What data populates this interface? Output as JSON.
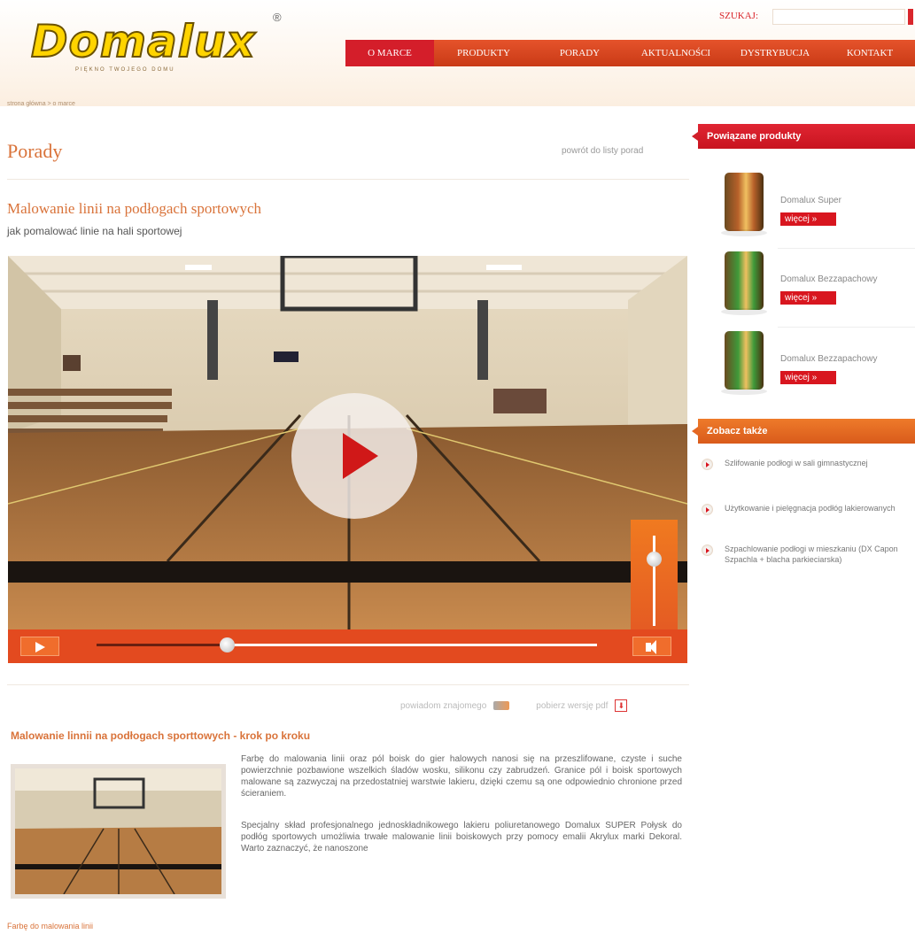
{
  "header": {
    "logo_text": "Domalux",
    "logo_tagline": "PIĘKNO TWOJEGO DOMU",
    "registered_mark": "®",
    "search_label": "SZUKAJ:",
    "search_placeholder": ""
  },
  "nav": {
    "items": [
      {
        "label": "O MARCE",
        "active": true
      },
      {
        "label": "PRODUKTY",
        "active": false
      },
      {
        "label": "PORADY",
        "active": false
      },
      {
        "label": "AKTUALNOŚCI",
        "active": false
      },
      {
        "label": "DYSTRYBUCJA",
        "active": false
      },
      {
        "label": "KONTAKT",
        "active": false
      }
    ]
  },
  "breadcrumb": "strona główna > o marce",
  "page": {
    "title": "Porady",
    "back_link": "powrót do listy porad"
  },
  "article": {
    "title": "Malowanie linii na podłogach sportowych",
    "subtitle": "jak pomalować linie na hali sportowej",
    "video": {
      "progress": 0.26,
      "volume": 0.75
    },
    "share": {
      "notify_friend": "powiadom znajomego",
      "download_pdf": "pobierz wersję pdf"
    },
    "steps_title": "Malowanie linnii na podłogach sporttowych - krok po kroku",
    "paragraph1": "Farbę do malowania linii oraz pól boisk do gier halowych nanosi się na przeszlifowane, czyste i suche powierzchnie pozbawione wszelkich śladów wosku, silikonu czy zabrudzeń. Granice pól i boisk sportowych malowane są zazwyczaj na przedostatniej warstwie lakieru, dzięki czemu są one odpowiednio chronione przed ścieraniem.",
    "paragraph2": "Specjalny skład profesjonalnego jednoskładnikowego lakieru poliuretanowego Domalux SUPER Połysk do podłóg sportowych umożliwia trwałe malowanie linii boiskowych przy pomocy emalii Akrylux marki Dekoral. Warto zaznaczyć, że nanoszone",
    "footer_link": "Farbę do malowania linii"
  },
  "sidebar": {
    "related_title": "Powiązane produkty",
    "products": [
      {
        "name": "Domalux Super",
        "more": "więcej »",
        "color": "#b8612a"
      },
      {
        "name": "Domalux Bezzapachowy",
        "more": "więcej »",
        "color": "#3f9a3a"
      },
      {
        "name": "Domalux Bezzapachowy",
        "more": "więcej »",
        "color": "#3f9a3a"
      }
    ],
    "see_also_title": "Zobacz także",
    "see_also": [
      "Szlifowanie podłogi w sali gimnastycznej",
      "Użytkowanie i pielęgnacja podłóg lakierowanych",
      "Szpachlowanie podłogi w mieszkaniu (DX Capon Szpachla + blacha parkieciarska)"
    ]
  },
  "colors": {
    "accent_red": "#d8161f",
    "accent_orange": "#e34a1f",
    "title_orange": "#d9733a"
  }
}
